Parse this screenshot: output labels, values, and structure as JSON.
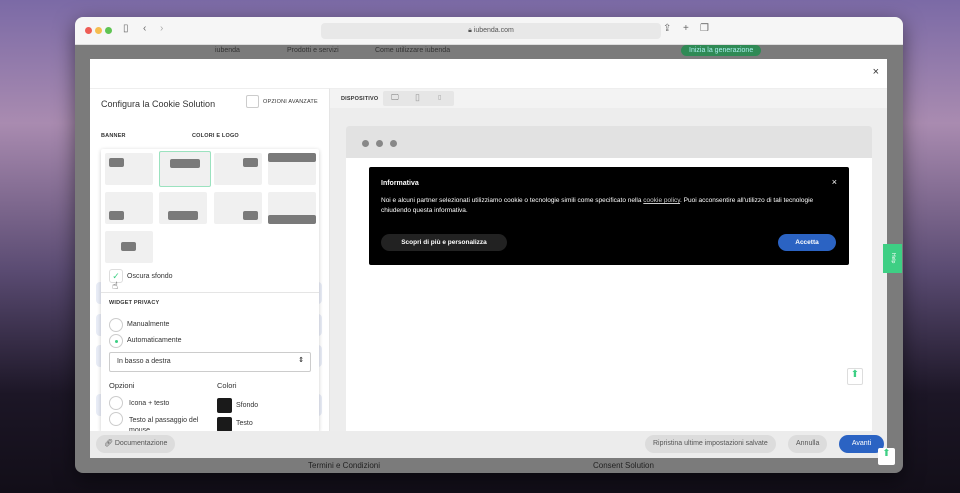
{
  "browser": {
    "url": "iubenda.com"
  },
  "background_page": {
    "nav": [
      "iubenda",
      "Prodotti e servizi",
      "Come utilizzare iubenda"
    ],
    "cta": "Inizia la generazione",
    "footer_links": [
      "Termini e Condizioni",
      "Consent Solution"
    ]
  },
  "modal": {
    "close": "×",
    "title": "Configura la Cookie Solution",
    "advanced_options": "OPZIONI AVANZATE",
    "device_label": "DISPOSITIVO",
    "tabs": {
      "banner": "BANNER",
      "colors": "COLORI E LOGO"
    },
    "popover": {
      "obscure_background": "Oscura sfondo",
      "obscure_checked": true,
      "widget_title": "WIDGET PRIVACY",
      "radio_manual": "Manualmente",
      "radio_auto": "Automaticamente",
      "selected": "Automaticamente",
      "position_select": "In basso a destra",
      "options_title": "Opzioni",
      "option_icon_text": "Icona + testo",
      "option_hover_text": "Testo al passaggio del mouse",
      "colors_title": "Colori",
      "color_bg": "Sfondo",
      "color_text": "Testo",
      "color_bg_value": "#1a1a1a",
      "color_text_value": "#1a1a1a"
    },
    "cookie_banner": {
      "title": "Informativa",
      "text_before": "Noi e alcuni partner selezionati utilizziamo cookie o tecnologie simili come specificato nella ",
      "link": "cookie policy",
      "text_after": ". Puoi acconsentire all'utilizzo di tali tecnologie chiudendo questa informativa.",
      "close": "×",
      "customize": "Scopri di più e personalizza",
      "accept": "Accetta"
    },
    "help_tab": "Help",
    "footer": {
      "docs": "Documentazione",
      "restore": "Ripristina ultime impostazioni salvate",
      "cancel": "Annulla",
      "next": "Avanti"
    }
  },
  "colors": {
    "accent_green": "#3ecf84",
    "primary_blue": "#2b63c3"
  }
}
